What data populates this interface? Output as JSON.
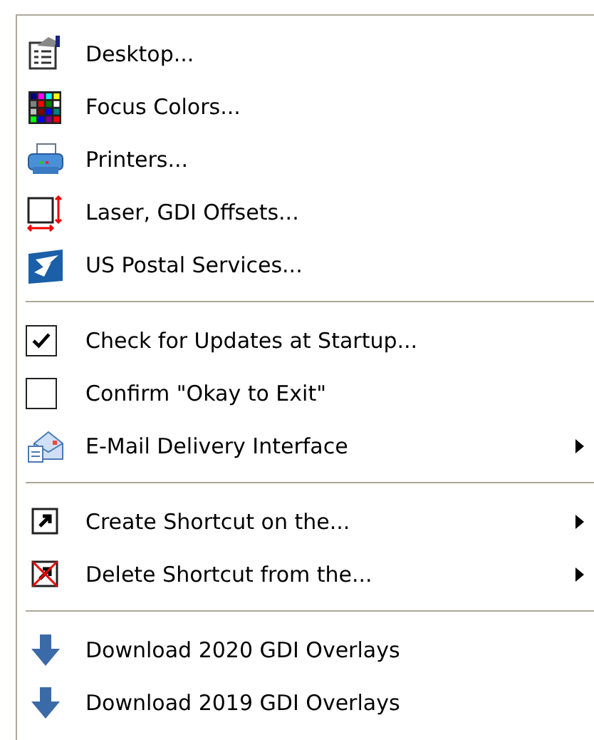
{
  "menu": {
    "groups": [
      {
        "items": [
          {
            "kind": "command",
            "label": "Desktop...",
            "submenu": false
          },
          {
            "kind": "command",
            "label": "Focus Colors...",
            "submenu": false
          },
          {
            "kind": "command",
            "label": "Printers...",
            "submenu": false
          },
          {
            "kind": "command",
            "label": "Laser, GDI Offsets...",
            "submenu": false
          },
          {
            "kind": "command",
            "label": "US Postal Services...",
            "submenu": false
          }
        ]
      },
      {
        "items": [
          {
            "kind": "checkbox",
            "label": "Check for Updates at Startup...",
            "checked": true
          },
          {
            "kind": "checkbox",
            "label": "Confirm \"Okay to Exit\"",
            "checked": false
          },
          {
            "kind": "command",
            "label": "E-Mail Delivery Interface",
            "submenu": true
          }
        ]
      },
      {
        "items": [
          {
            "kind": "command",
            "label": "Create Shortcut on the...",
            "submenu": true
          },
          {
            "kind": "command",
            "label": "Delete Shortcut from the...",
            "submenu": true
          }
        ]
      },
      {
        "items": [
          {
            "kind": "command",
            "label": "Download 2020 GDI Overlays",
            "submenu": false
          },
          {
            "kind": "command",
            "label": "Download 2019 GDI Overlays",
            "submenu": false
          }
        ]
      }
    ]
  }
}
